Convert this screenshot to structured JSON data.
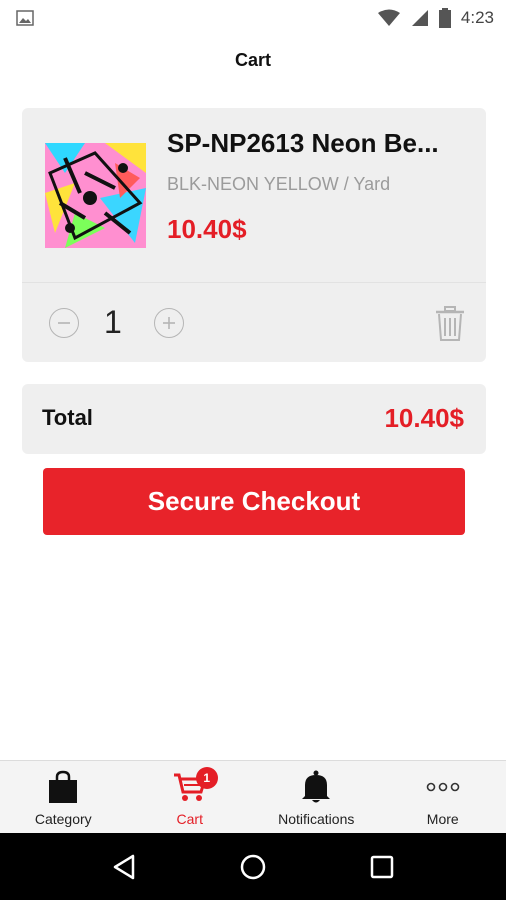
{
  "status_bar": {
    "time": "4:23",
    "icons": [
      "image-icon",
      "wifi-icon",
      "signal-icon",
      "battery-icon"
    ]
  },
  "header": {
    "title": "Cart"
  },
  "cart_item": {
    "name": "SP-NP2613 Neon Be...",
    "variant": "BLK-NEON YELLOW / Yard",
    "price": "10.40$",
    "quantity": "1"
  },
  "summary": {
    "total_label": "Total",
    "total_value": "10.40$"
  },
  "checkout": {
    "label": "Secure Checkout"
  },
  "bottom_nav": {
    "items": [
      {
        "label": "Category",
        "icon": "shopping-bag-icon"
      },
      {
        "label": "Cart",
        "icon": "cart-icon",
        "badge": "1",
        "active": true
      },
      {
        "label": "Notifications",
        "icon": "bell-icon"
      },
      {
        "label": "More",
        "icon": "more-dots-icon"
      }
    ]
  },
  "colors": {
    "accent": "#e41e26",
    "card_bg": "#efefef",
    "muted_text": "#9b9b9b"
  }
}
